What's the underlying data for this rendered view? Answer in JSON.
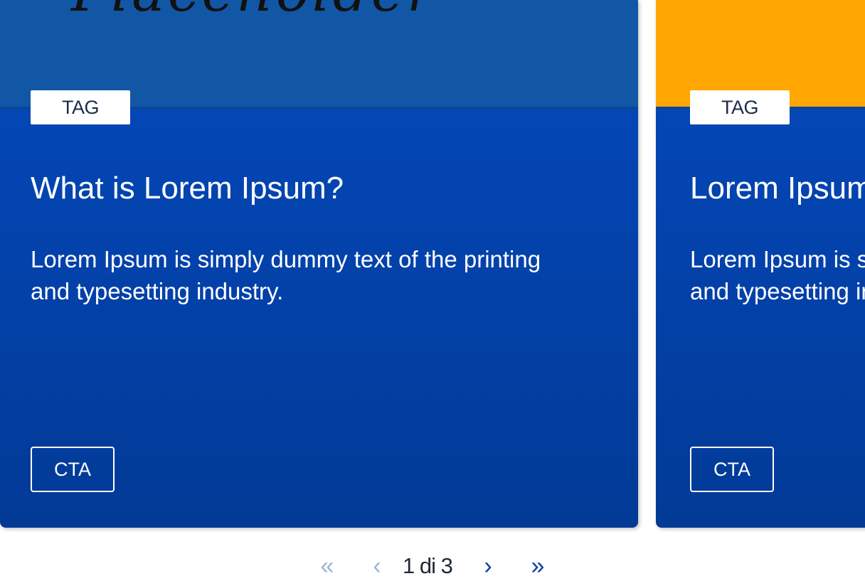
{
  "cards": [
    {
      "image_text": "Placeholder",
      "image_color": "#1256a6",
      "tag": "TAG",
      "title": "What is Lorem Ipsum?",
      "text": "Lorem Ipsum is simply dummy text of the printing and typesetting industry.",
      "cta": "CTA"
    },
    {
      "image_color": "#ffa600",
      "tag": "TAG",
      "title": "Lorem Ipsum",
      "text": "Lorem Ipsum is simply dummy text of the printing and typesetting industry.",
      "cta": "CTA"
    }
  ],
  "pagination": {
    "first_icon": "«",
    "prev_icon": "‹",
    "label": "1 di 3",
    "next_icon": "›",
    "last_icon": "»"
  },
  "colors": {
    "card_blue": "#0349bd",
    "image_orange": "#ffa600",
    "disabled_nav": "#9fb3d6",
    "active_nav": "#0b3fa0"
  }
}
